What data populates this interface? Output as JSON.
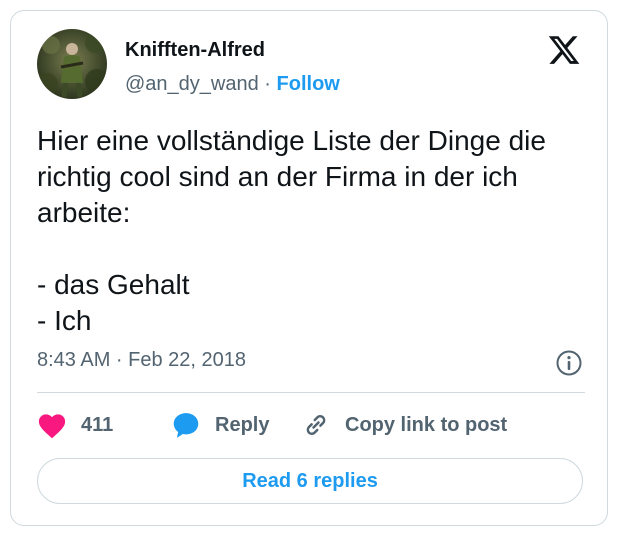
{
  "author": {
    "name": "Knifften-Alfred",
    "handle": "@an_dy_wand",
    "separator": "·",
    "follow_label": "Follow",
    "avatar_icon": "avatar-photo"
  },
  "tweet": {
    "text": "Hier eine vollständige Liste der Dinge die richtig cool sind an der Firma in der ich arbeite:\n\n- das Gehalt\n- Ich",
    "timestamp": "8:43 AM · Feb 22, 2018"
  },
  "actions": {
    "like_count": "411",
    "reply_label": "Reply",
    "copy_label": "Copy link to post"
  },
  "read_replies_label": "Read 6 replies",
  "icons": {
    "logo": "x-logo-icon",
    "info": "info-icon",
    "like": "heart-icon",
    "reply": "reply-bubble-icon",
    "copy": "link-icon"
  },
  "colors": {
    "accent": "#1d9bf0",
    "like": "#f91880",
    "text": "#0f1419",
    "muted": "#536471",
    "border": "#cfd9de"
  }
}
